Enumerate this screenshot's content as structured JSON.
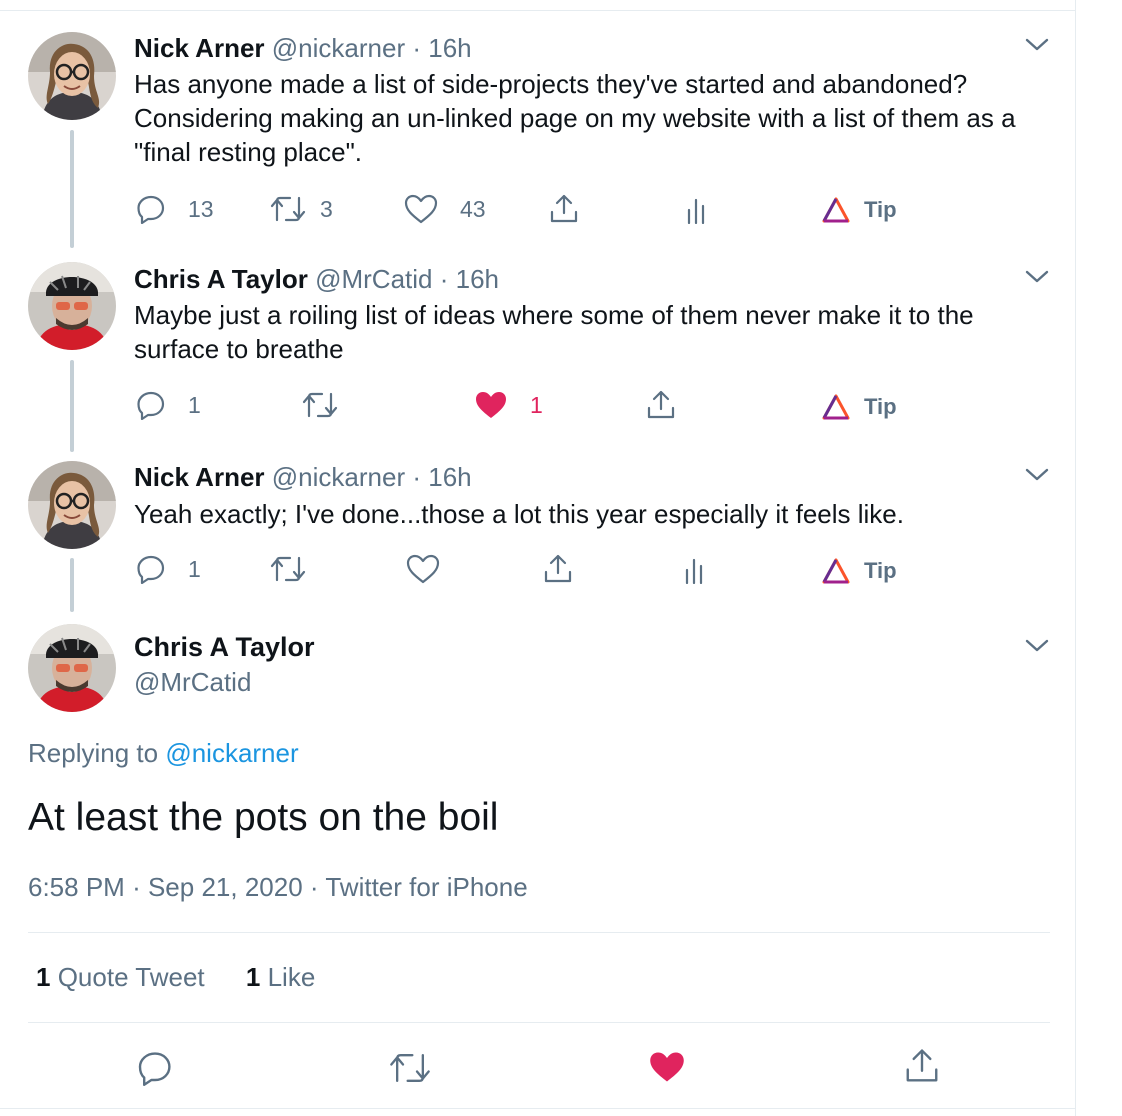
{
  "tweets": [
    {
      "name": "Nick Arner",
      "handle": "@nickarner",
      "time": "16h",
      "text": "Has anyone made a list of side-projects they've started and abandoned? Considering making an un-linked page on my website with a list of them as a \"final resting place\".",
      "replies": "13",
      "retweets": "3",
      "likes": "43",
      "liked": false,
      "tip": "Tip"
    },
    {
      "name": "Chris A Taylor",
      "handle": "@MrCatid",
      "time": "16h",
      "text": "Maybe just a roiling list of ideas where some of them never make it to the surface to breathe",
      "replies": "1",
      "retweets": "",
      "likes": "1",
      "liked": true,
      "tip": "Tip"
    },
    {
      "name": "Nick Arner",
      "handle": "@nickarner",
      "time": "16h",
      "text": "Yeah exactly; I've done...those a lot this year especially it feels like.",
      "replies": "1",
      "retweets": "",
      "likes": "",
      "liked": false,
      "tip": "Tip"
    }
  ],
  "separator": "·",
  "main_tweet": {
    "name": "Chris A Taylor",
    "handle": "@MrCatid",
    "replying_prefix": "Replying to",
    "replying_to": "@nickarner",
    "text": "At least the pots on the boil",
    "time": "6:58 PM",
    "date": "Sep 21, 2020",
    "source": "Twitter for iPhone",
    "quote_count": "1",
    "quote_label": "Quote Tweet",
    "like_count": "1",
    "like_label": "Like",
    "liked": true
  },
  "colors": {
    "text_primary": "#0f1419",
    "text_secondary": "#5b7083",
    "link": "#1b95e0",
    "like": "#e0245e",
    "divider": "#e6ecf0",
    "thread_line": "#c4cfd6"
  },
  "icons": [
    "chevron-down-icon",
    "reply-icon",
    "retweet-icon",
    "like-icon",
    "share-icon",
    "analytics-icon",
    "brave-tip-icon"
  ]
}
